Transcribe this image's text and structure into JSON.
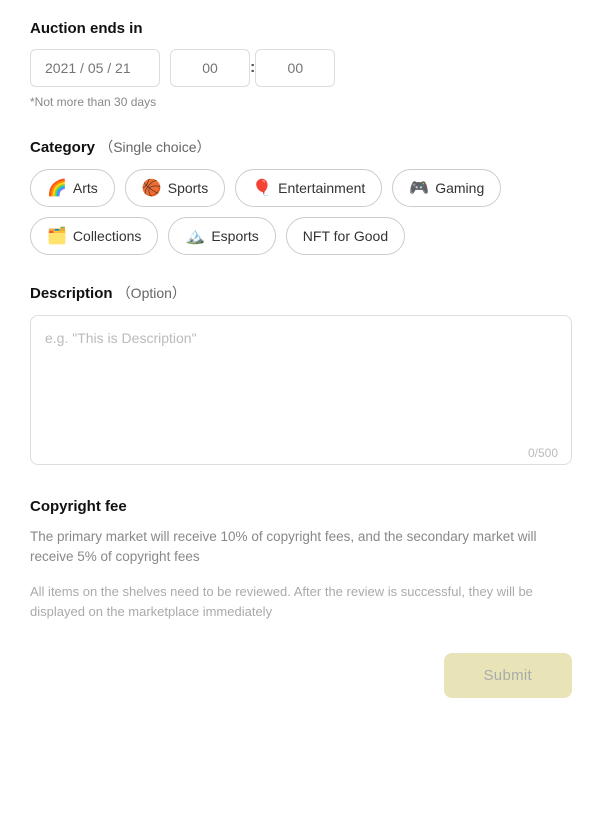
{
  "auction": {
    "title": "Auction ends in",
    "date_placeholder": "2021 / 05 / 21",
    "hour_placeholder": "00",
    "minute_placeholder": "00",
    "hint": "*Not more than 30 days"
  },
  "category": {
    "title": "Category",
    "subtitle": "（Single choice）",
    "chips": [
      {
        "id": "arts",
        "emoji": "🌈",
        "label": "Arts"
      },
      {
        "id": "sports",
        "emoji": "🏀",
        "label": "Sports"
      },
      {
        "id": "entertainment",
        "emoji": "🎈",
        "label": "Entertainment"
      },
      {
        "id": "gaming",
        "emoji": "🎮",
        "label": "Gaming"
      },
      {
        "id": "collections",
        "emoji": "🗂️",
        "label": "Collections"
      },
      {
        "id": "esports",
        "emoji": "🏔️",
        "label": "Esports"
      },
      {
        "id": "nft-for-good",
        "emoji": "",
        "label": "NFT for Good"
      }
    ]
  },
  "description": {
    "title": "Description",
    "subtitle": "（Option）",
    "placeholder": "e.g. \"This is Description\"",
    "char_count": "0/500"
  },
  "copyright": {
    "title": "Copyright fee",
    "primary_text": "The primary market will receive 10% of copyright fees, and the secondary market will receive 5% of copyright fees",
    "secondary_text": "All items on the shelves need to be reviewed. After the review is successful, they will be displayed on the marketplace immediately"
  },
  "submit": {
    "label": "Submit"
  }
}
